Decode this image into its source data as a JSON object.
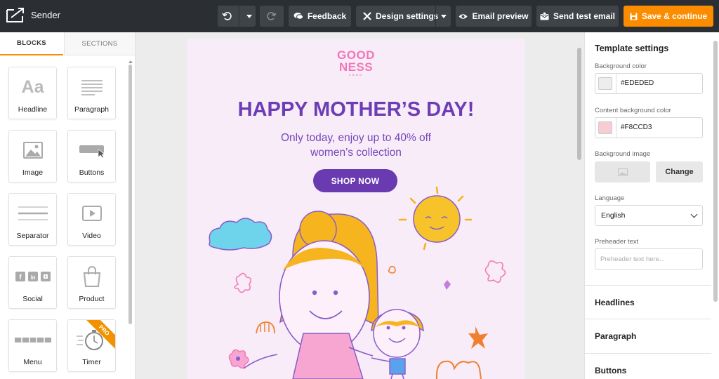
{
  "app": {
    "name": "Sender"
  },
  "toolbar": {
    "feedback": "Feedback",
    "design_settings": "Design settings",
    "email_preview": "Email preview",
    "send_test": "Send test email",
    "save": "Save & continue",
    "colors": {
      "bar": "#2b2f33",
      "button": "#3f4449",
      "primary": "#fb8c00"
    }
  },
  "left_panel": {
    "tabs": [
      "BLOCKS",
      "SECTIONS"
    ],
    "blocks": [
      {
        "label": "Headline",
        "icon": "headline-icon"
      },
      {
        "label": "Paragraph",
        "icon": "paragraph-icon"
      },
      {
        "label": "Image",
        "icon": "image-icon"
      },
      {
        "label": "Buttons",
        "icon": "buttons-icon"
      },
      {
        "label": "Separator",
        "icon": "separator-icon"
      },
      {
        "label": "Video",
        "icon": "video-icon"
      },
      {
        "label": "Social",
        "icon": "social-icon"
      },
      {
        "label": "Product",
        "icon": "product-icon"
      },
      {
        "label": "Menu",
        "icon": "menu-icon"
      },
      {
        "label": "Timer",
        "icon": "timer-icon"
      }
    ],
    "headline_icon_text": "Aa",
    "pro_badge": "PRO"
  },
  "email": {
    "logo_line1": "GOOD",
    "logo_line2": "NESS",
    "logo_tag": "LOGO",
    "headline": "HAPPY MOTHER’S DAY!",
    "subtext_line1": "Only today, enjoy up to 40% off",
    "subtext_line2": "women’s collection",
    "cta": "SHOP NOW",
    "colors": {
      "background": "#f8ecf8",
      "headline": "#6c3db5",
      "button": "#6a3ab0",
      "logo": "#f377b8"
    }
  },
  "right_panel": {
    "title": "Template settings",
    "bg_color_label": "Background color",
    "bg_color_value": "#EDEDED",
    "content_bg_label": "Content background color",
    "content_bg_value": "#F8CCD3",
    "bg_image_label": "Background image",
    "change_label": "Change",
    "language_label": "Language",
    "language_value": "English",
    "preheader_label": "Preheader text",
    "preheader_placeholder": "Preheader text here...",
    "sections": [
      "Headlines",
      "Paragraph",
      "Buttons"
    ]
  }
}
